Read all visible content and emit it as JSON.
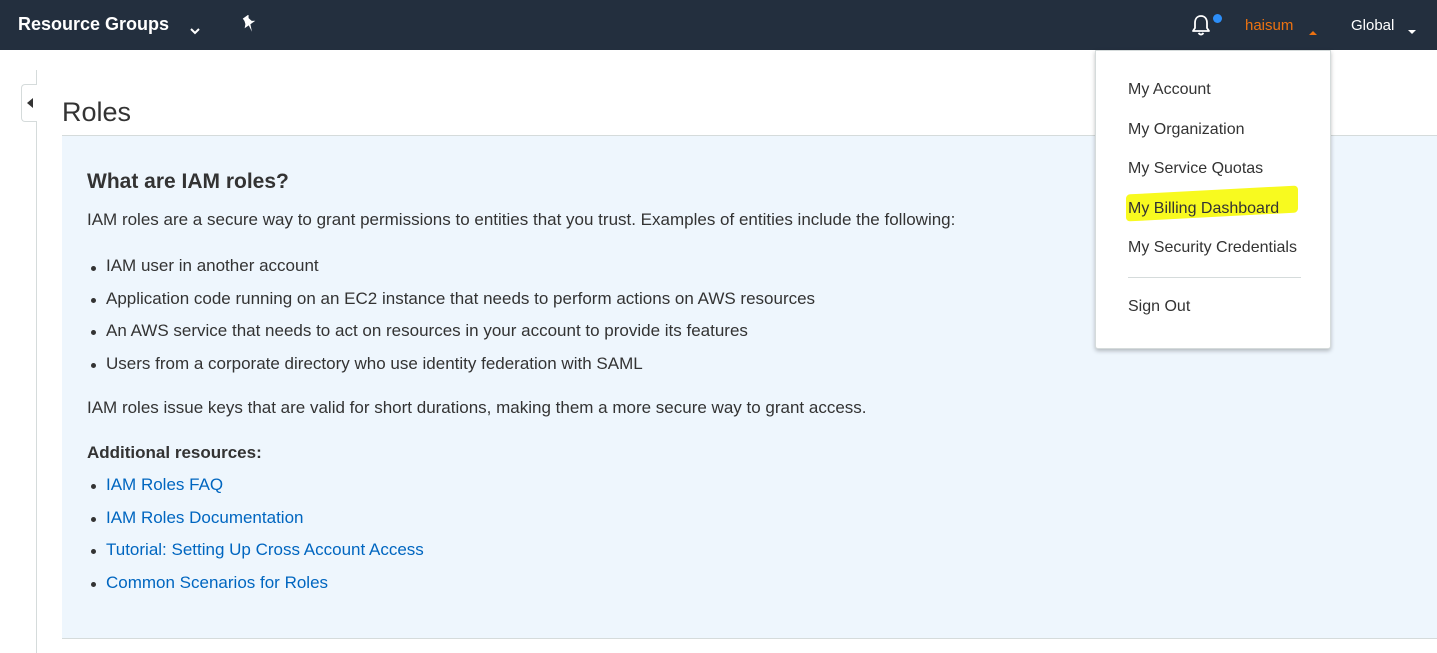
{
  "topnav": {
    "resource_groups": "Resource Groups",
    "username": "haisum",
    "region": "Global",
    "notification_dot_color": "#2c8ef8"
  },
  "page": {
    "title": "Roles"
  },
  "info": {
    "heading": "What are IAM roles?",
    "intro": "IAM roles are a secure way to grant permissions to entities that you trust. Examples of entities include the following:",
    "entities": [
      "IAM user in another account",
      "Application code running on an EC2 instance that needs to perform actions on AWS resources",
      "An AWS service that needs to act on resources in your account to provide its features",
      "Users from a corporate directory who use identity federation with SAML"
    ],
    "keys_note": "IAM roles issue keys that are valid for short durations, making them a more secure way to grant access.",
    "resources_heading": "Additional resources:",
    "resources": [
      "IAM Roles FAQ",
      "IAM Roles Documentation",
      "Tutorial: Setting Up Cross Account Access",
      "Common Scenarios for Roles"
    ]
  },
  "account_menu": {
    "items": [
      "My Account",
      "My Organization",
      "My Service Quotas",
      "My Billing Dashboard",
      "My Security Credentials"
    ],
    "sign_out": "Sign Out",
    "highlight_color": "#f8fa1f"
  },
  "colors": {
    "nav_bg": "#232f3e",
    "accent_orange": "#ec7211",
    "link_blue": "#0066c0",
    "panel_bg": "#eef6fd"
  },
  "icons": [
    "chevron-down-icon",
    "pin-icon",
    "bell-icon",
    "chevron-up-icon",
    "chevron-left-icon"
  ]
}
